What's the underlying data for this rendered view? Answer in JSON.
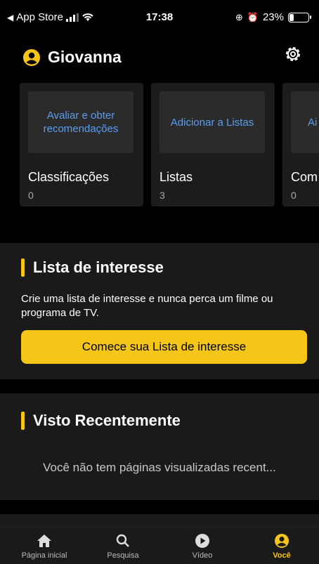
{
  "status_bar": {
    "carrier": "App Store",
    "time": "17:38",
    "battery": "23%",
    "battery_level": 0.23
  },
  "header": {
    "user_name": "Giovanna",
    "settings_icon": "gear-icon",
    "avatar_icon": "user-circle-icon"
  },
  "cards": [
    {
      "action": "Avaliar e obter recomendações",
      "title": "Classificações",
      "count": "0"
    },
    {
      "action": "Adicionar a Listas",
      "title": "Listas",
      "count": "3"
    },
    {
      "action": "Ai",
      "title": "Com",
      "count": "0"
    }
  ],
  "watchlist": {
    "heading": "Lista de interesse",
    "description": "Crie uma lista de interesse e nunca perca um filme ou programa de TV.",
    "cta": "Comece sua Lista de interesse"
  },
  "recent": {
    "heading": "Visto Recentemente",
    "empty": "Você não tem páginas visualizadas recent..."
  },
  "tabbar": [
    {
      "label": "Página inicial",
      "icon": "home-icon"
    },
    {
      "label": "Pesquisa",
      "icon": "search-icon"
    },
    {
      "label": "Vídeo",
      "icon": "play-icon"
    },
    {
      "label": "Você",
      "icon": "user-circle-icon",
      "active": true
    }
  ],
  "colors": {
    "accent": "#f5c518",
    "link": "#5b9df2",
    "background": "#000000",
    "surface": "#1a1a1a"
  }
}
